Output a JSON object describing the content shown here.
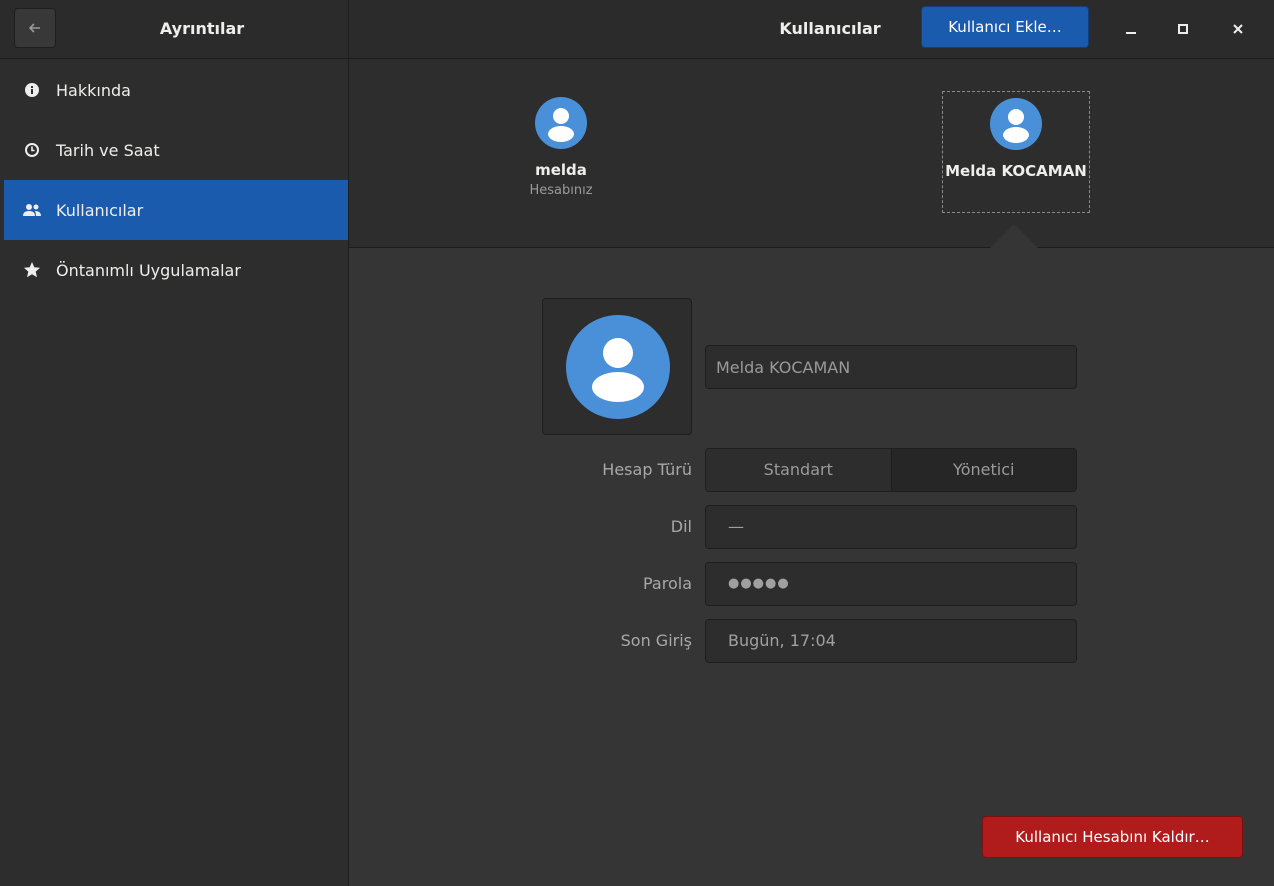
{
  "header": {
    "left_title": "Ayrıntılar",
    "right_title": "Kullanıcılar",
    "add_user_label": "Kullanıcı Ekle…"
  },
  "sidebar": {
    "items": [
      {
        "label": "Hakkında",
        "icon": "info-icon"
      },
      {
        "label": "Tarih ve Saat",
        "icon": "clock-icon"
      },
      {
        "label": "Kullanıcılar",
        "icon": "users-icon",
        "active": true
      },
      {
        "label": "Öntanımlı Uygulamalar",
        "icon": "star-icon"
      }
    ]
  },
  "users": [
    {
      "name": "melda",
      "subtitle": "Hesabınız"
    },
    {
      "name": "Melda KOCAMAN",
      "subtitle": "",
      "selected": true
    }
  ],
  "detail": {
    "full_name": "Melda KOCAMAN",
    "account_type_label": "Hesap Türü",
    "account_type_options": [
      "Standart",
      "Yönetici"
    ],
    "account_type_selected": "Yönetici",
    "language_label": "Dil",
    "language_value": "—",
    "password_label": "Parola",
    "password_value": "●●●●●",
    "last_login_label": "Son Giriş",
    "last_login_value": "Bugün, 17:04",
    "remove_label": "Kullanıcı Hesabını Kaldır…"
  },
  "colors": {
    "accent": "#1b5bad",
    "destructive": "#b01c1c",
    "avatar": "#4a90d9"
  }
}
